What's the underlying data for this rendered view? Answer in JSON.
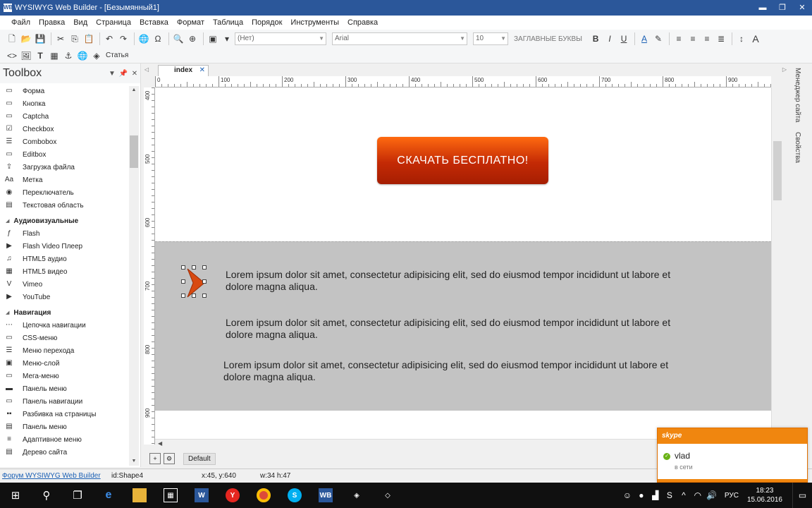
{
  "window": {
    "title": "WYSIWYG Web Builder - [Безымянный1]",
    "icon": "WB",
    "min": "▬",
    "restore": "❐",
    "close": "✕"
  },
  "menu": [
    "Файл",
    "Правка",
    "Вид",
    "Страница",
    "Вставка",
    "Формат",
    "Таблица",
    "Порядок",
    "Инструменты",
    "Справка"
  ],
  "toolbar": {
    "style_value": "(Нет)",
    "font_value": "Arial",
    "size_value": "10",
    "caps_label": "ЗАГЛАВНЫЕ БУКВЫ",
    "bold": "B",
    "italic": "I",
    "underline": "U",
    "font_color": "A",
    "styles_label": "A",
    "article_label": "Статья"
  },
  "toolbox": {
    "title": "Toolbox",
    "groups": [
      {
        "type": "item",
        "label": "Форма",
        "icon": "▭"
      },
      {
        "type": "item",
        "label": "Кнопка",
        "icon": "▭"
      },
      {
        "type": "item",
        "label": "Captcha",
        "icon": "▭"
      },
      {
        "type": "item",
        "label": "Checkbox",
        "icon": "☑"
      },
      {
        "type": "item",
        "label": "Combobox",
        "icon": "☰"
      },
      {
        "type": "item",
        "label": "Editbox",
        "icon": "▭"
      },
      {
        "type": "item",
        "label": "Загрузка файла",
        "icon": "⇪"
      },
      {
        "type": "item",
        "label": "Метка",
        "icon": "Aa"
      },
      {
        "type": "item",
        "label": "Переключатель",
        "icon": "◉"
      },
      {
        "type": "item",
        "label": "Текстовая область",
        "icon": "▤"
      },
      {
        "type": "group",
        "label": "Аудиовизуальные"
      },
      {
        "type": "item",
        "label": "Flash",
        "icon": "ƒ"
      },
      {
        "type": "item",
        "label": "Flash Video Плеер",
        "icon": "▶"
      },
      {
        "type": "item",
        "label": "HTML5 аудио",
        "icon": "♫"
      },
      {
        "type": "item",
        "label": "HTML5 видео",
        "icon": "▦"
      },
      {
        "type": "item",
        "label": "Vimeo",
        "icon": "V"
      },
      {
        "type": "item",
        "label": "YouTube",
        "icon": "▶"
      },
      {
        "type": "group",
        "label": "Навигация"
      },
      {
        "type": "item",
        "label": "Цепочка навигации",
        "icon": "⋯"
      },
      {
        "type": "item",
        "label": "CSS-меню",
        "icon": "▭"
      },
      {
        "type": "item",
        "label": "Меню перехода",
        "icon": "☰"
      },
      {
        "type": "item",
        "label": "Меню-слой",
        "icon": "▣"
      },
      {
        "type": "item",
        "label": "Мега-меню",
        "icon": "▭"
      },
      {
        "type": "item",
        "label": "Панель меню",
        "icon": "▬"
      },
      {
        "type": "item",
        "label": "Панель навигации",
        "icon": "▭"
      },
      {
        "type": "item",
        "label": "Разбивка на страницы",
        "icon": "▪▪"
      },
      {
        "type": "item",
        "label": "Панель меню",
        "icon": "▤"
      },
      {
        "type": "item",
        "label": "Адаптивное меню",
        "icon": "≡"
      },
      {
        "type": "item",
        "label": "Дерево сайта",
        "icon": "▤"
      }
    ]
  },
  "editor": {
    "tab": "index",
    "ruler_labels": [
      "0",
      "100",
      "200",
      "300",
      "400",
      "500",
      "600",
      "700",
      "800",
      "900"
    ],
    "ruler_left_labels": [
      "400",
      "500",
      "600",
      "700",
      "800",
      "900"
    ],
    "cta_text": "СКАЧАТЬ БЕСПЛАТНО!",
    "paragraphs": [
      "Lorem ipsum dolor sit amet, consectetur adipisicing elit, sed do eiusmod tempor incididunt ut labore et dolore magna aliqua.",
      "Lorem ipsum dolor sit amet, consectetur adipisicing elit, sed do eiusmod tempor incididunt ut labore et dolore magna aliqua.",
      "Lorem ipsum dolor sit amet, consectetur adipisicing elit, sed do eiusmod tempor incididunt ut labore et dolore magna aliqua."
    ],
    "bottom_tab": "Default",
    "colors": {
      "cta_top": "#ff6a10",
      "cta_bottom": "#a51e02",
      "band": "#c3c3c3",
      "arrow": "#d84a10"
    }
  },
  "side_tabs": [
    "Менеджер сайта",
    "Свойства"
  ],
  "status": {
    "forum_link": "Форум WYSIWYG Web Builder",
    "id": "id:Shape4",
    "coords": "x:45, y:640",
    "size": "w:34 h:47"
  },
  "skype": {
    "brand": "skype",
    "user": "vlad",
    "status": "в сети"
  },
  "taskbar": {
    "lang": "РУС",
    "time": "18:23",
    "date": "15.06.2016"
  }
}
